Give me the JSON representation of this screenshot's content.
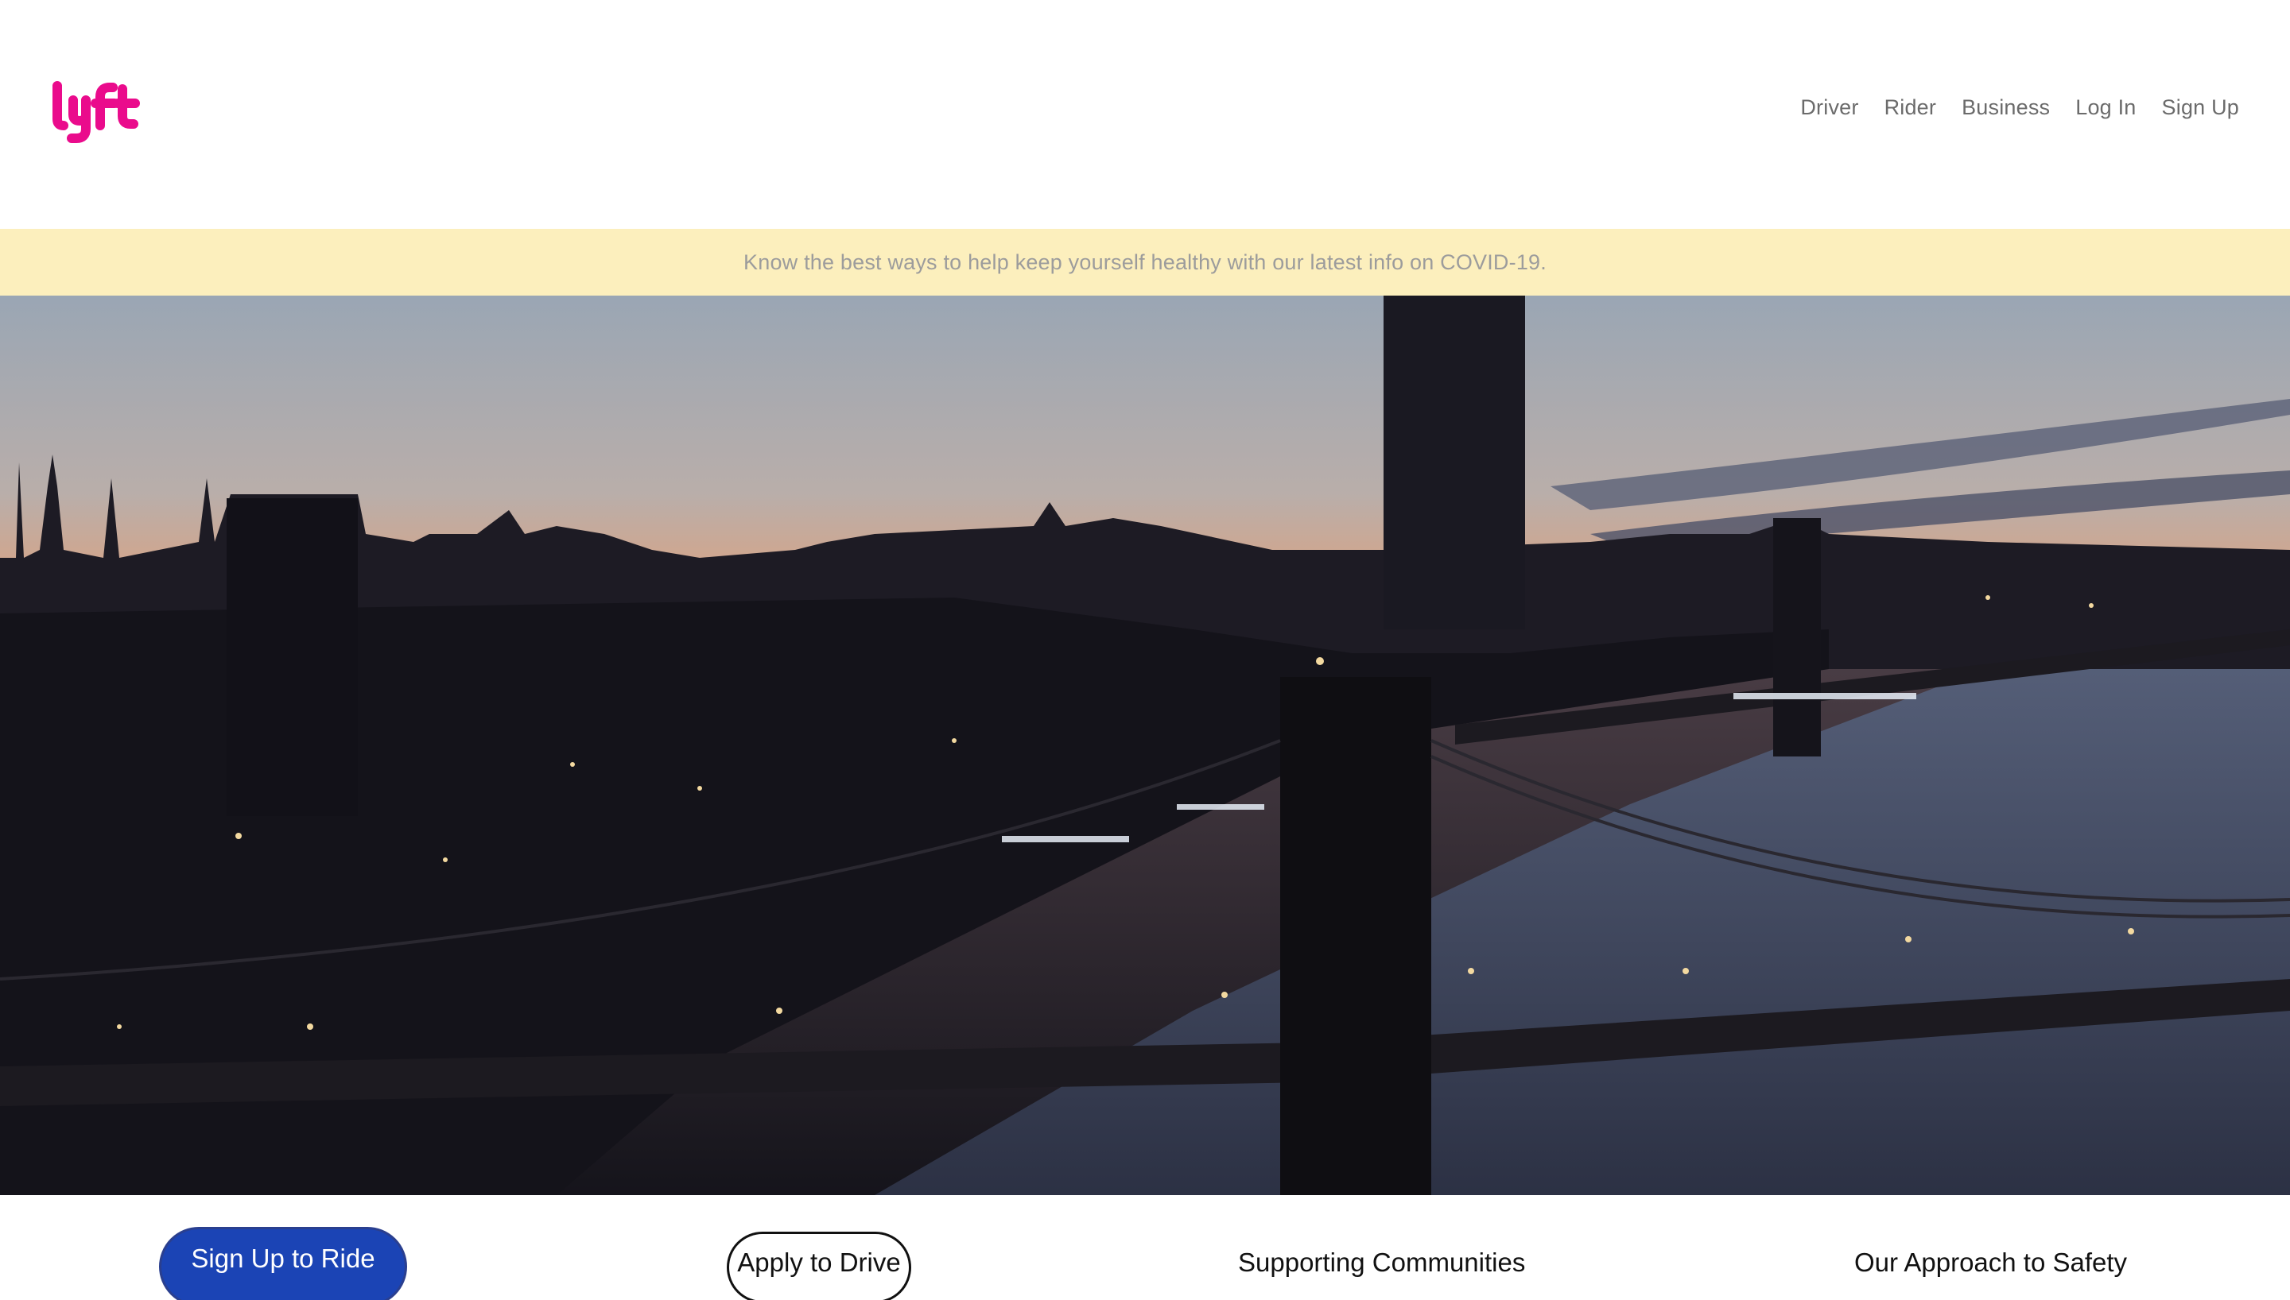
{
  "brand": {
    "logo_text": "lyft",
    "color": "#ea0b8c"
  },
  "nav": {
    "items": [
      {
        "label": "Driver"
      },
      {
        "label": "Rider"
      },
      {
        "label": "Business"
      },
      {
        "label": "Log In"
      },
      {
        "label": "Sign Up"
      }
    ]
  },
  "banner": {
    "text": "Know the best ways to help keep yourself healthy with our latest info on COVID-19.",
    "background": "#fcefbd"
  },
  "hero": {
    "scene": "city-skyline-bridge-dusk"
  },
  "cta": {
    "primary_label": "Sign Up to Ride",
    "secondary_label": "Apply to Drive",
    "communities_label": "Supporting Communities",
    "safety_label": "Our Approach to Safety",
    "primary_color": "#1b44b5"
  }
}
